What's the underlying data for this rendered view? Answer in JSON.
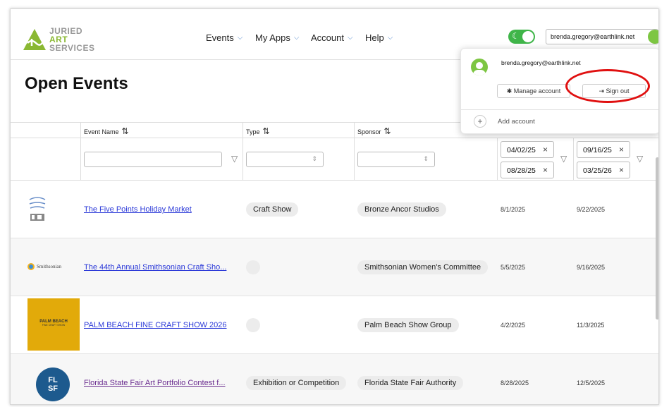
{
  "logo": {
    "line1": "JURIED",
    "line2": "ART",
    "line3": "SERVICES"
  },
  "nav": [
    {
      "label": "Events"
    },
    {
      "label": "My Apps"
    },
    {
      "label": "Account"
    },
    {
      "label": "Help"
    }
  ],
  "header": {
    "user_email": "brenda.gregory@earthlink.net",
    "dark_mode": true
  },
  "page": {
    "title": "Open Events"
  },
  "table": {
    "headers": {
      "event_name": "Event Name",
      "type": "Type",
      "sponsor": "Sponsor"
    },
    "filters": {
      "deadline_dates": [
        "04/02/25",
        "08/28/25"
      ],
      "event_dates": [
        "09/16/25",
        "03/25/26"
      ]
    },
    "rows": [
      {
        "name": "The Five Points Holiday Market",
        "type": "Craft Show",
        "sponsor": "Bronze Ancor Studios",
        "deadline": "8/1/2025",
        "event_date": "9/22/2025"
      },
      {
        "name": "The 44th Annual Smithsonian Craft Sho...",
        "type": "",
        "sponsor": "Smithsonian Women's Committee",
        "deadline": "5/5/2025",
        "event_date": "9/16/2025",
        "thumb_label": "Smithsonian"
      },
      {
        "name": "PALM BEACH FINE CRAFT SHOW 2026",
        "type": "",
        "sponsor": "Palm Beach Show Group",
        "deadline": "4/2/2025",
        "event_date": "11/3/2025",
        "thumb_label": "PALM BEACH",
        "thumb_sub": "FINE CRAFT SHOW"
      },
      {
        "name": "Florida State Fair Art Portfolio Contest f...",
        "type": "Exhibition or Competition",
        "sponsor": "Florida State Fair Authority",
        "deadline": "8/28/2025",
        "event_date": "12/5/2025",
        "thumb_label1": "FL",
        "thumb_label2": "SF"
      }
    ]
  },
  "account_menu": {
    "email": "brenda.gregory@earthlink.net",
    "manage_label": "Manage account",
    "signout_label": "Sign out",
    "add_label": "Add account"
  },
  "colors": {
    "brand_green": "#8ab832",
    "toggle_green": "#3fb549",
    "link_blue": "#2a38d8",
    "highlight_red": "#e01010"
  }
}
